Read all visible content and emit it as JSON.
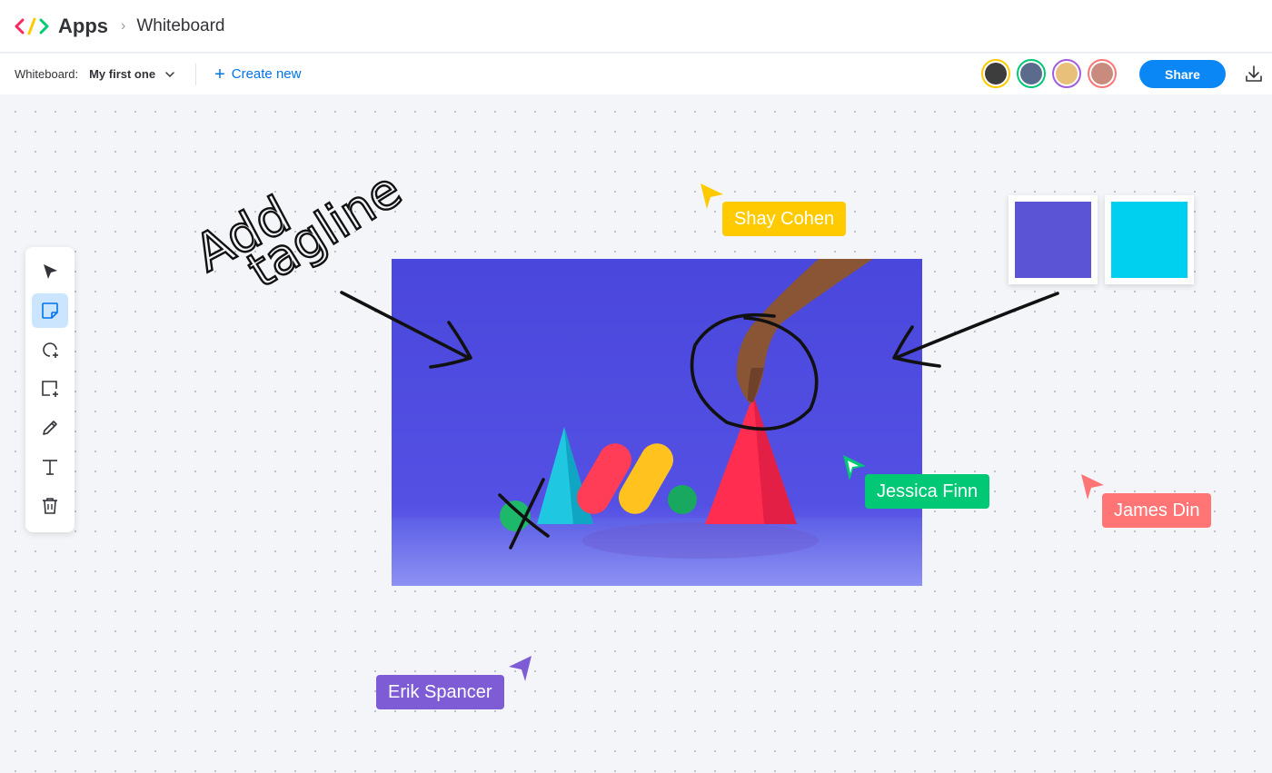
{
  "header": {
    "app_title": "Apps",
    "breadcrumb": "Whiteboard",
    "logo_colors": [
      "#fb275d",
      "#ffcb00",
      "#00ca72"
    ]
  },
  "toolbar": {
    "label": "Whiteboard:",
    "board_name": "My first one",
    "create_new": "Create new",
    "share": "Share",
    "avatars": [
      {
        "border": "#ffcb00",
        "fill": "#3d3d3d"
      },
      {
        "border": "#00c875",
        "fill": "#5b6b8c"
      },
      {
        "border": "#a25ddc",
        "fill": "#e8c07a"
      },
      {
        "border": "#ff7575",
        "fill": "#c98b7e"
      }
    ]
  },
  "tools": [
    {
      "icon": "pointer-icon",
      "active": false
    },
    {
      "icon": "sticky-note-icon",
      "active": true
    },
    {
      "icon": "shape-add-icon",
      "active": false
    },
    {
      "icon": "frame-add-icon",
      "active": false
    },
    {
      "icon": "pen-icon",
      "active": false
    },
    {
      "icon": "text-icon",
      "active": false
    },
    {
      "icon": "trash-icon",
      "active": false
    }
  ],
  "canvas": {
    "handwriting": [
      "Add",
      "tagline"
    ],
    "swatches": [
      "#5b55d6",
      "#00d0ef"
    ],
    "cursors": [
      {
        "name": "Shay Cohen",
        "color": "#ffcb00"
      },
      {
        "name": "Jessica Finn",
        "color": "#00c875"
      },
      {
        "name": "James Din",
        "color": "#ff7575"
      },
      {
        "name": "Erik Spancer",
        "color": "#7e5cd6"
      }
    ],
    "photo_bg": "#4b4fe0"
  }
}
